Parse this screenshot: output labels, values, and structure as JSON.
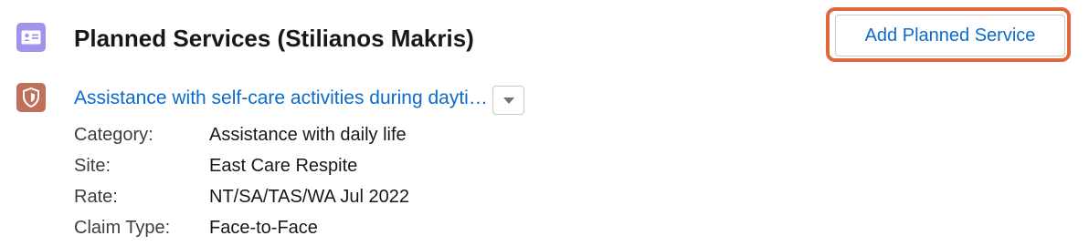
{
  "header": {
    "title": "Planned Services (Stilianos Makris)",
    "icon": "contact-card-icon",
    "icon_color": "#a094ed",
    "add_button_label": "Add Planned Service",
    "highlight_color": "#e0663c"
  },
  "item": {
    "icon": "shield-icon",
    "icon_color": "#c0705a",
    "title": "Assistance with self-care activities during daytime",
    "menu_icon": "chevron-down-icon",
    "details": [
      {
        "label": "Category:",
        "value": "Assistance with daily life"
      },
      {
        "label": "Site:",
        "value": "East Care Respite"
      },
      {
        "label": "Rate:",
        "value": "NT/SA/TAS/WA Jul 2022"
      },
      {
        "label": "Claim Type:",
        "value": "Face-to-Face"
      }
    ]
  },
  "colors": {
    "link": "#0b6bcb",
    "text": "#181818",
    "label": "#3e3e3c"
  }
}
